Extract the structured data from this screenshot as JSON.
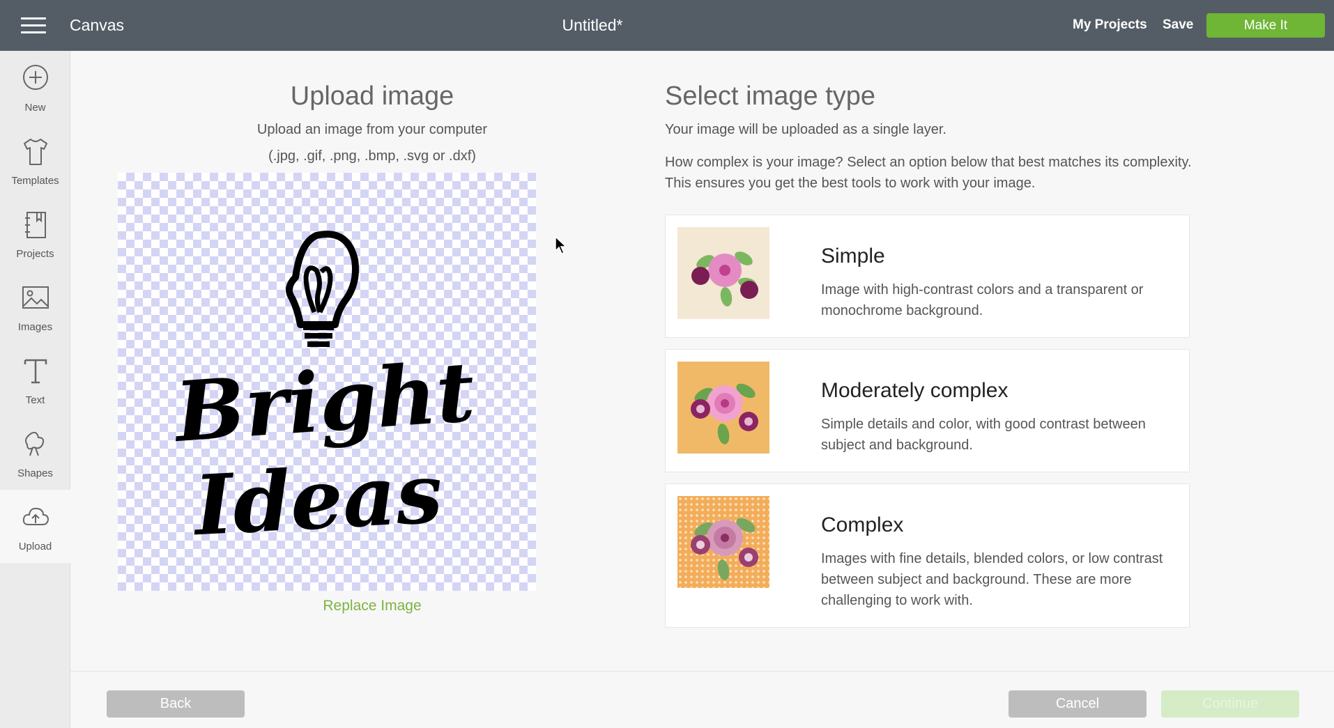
{
  "header": {
    "app_name": "Canvas",
    "doc_title": "Untitled*",
    "my_projects": "My Projects",
    "save": "Save",
    "make_it": "Make It"
  },
  "sidebar": {
    "items": [
      {
        "label": "New",
        "icon": "plus-circle-icon"
      },
      {
        "label": "Templates",
        "icon": "tshirt-icon"
      },
      {
        "label": "Projects",
        "icon": "notebook-icon"
      },
      {
        "label": "Images",
        "icon": "image-icon"
      },
      {
        "label": "Text",
        "icon": "text-t-icon"
      },
      {
        "label": "Shapes",
        "icon": "shapes-icon"
      },
      {
        "label": "Upload",
        "icon": "cloud-upload-icon"
      }
    ],
    "active": "Upload"
  },
  "upload": {
    "title": "Upload image",
    "subtitle": "Upload an image from your computer",
    "extensions": "(.jpg, .gif, .png, .bmp, .svg or .dxf)",
    "preview_text_line1": "Bright",
    "preview_text_line2": "Ideas",
    "replace": "Replace Image"
  },
  "select": {
    "title": "Select image type",
    "subtitle": "Your image will be uploaded as a single layer.",
    "description": "How complex is your image? Select an option below that best matches its complexity. This ensures you get the best tools to work with your image.",
    "types": [
      {
        "name": "Simple",
        "description": "Image with high-contrast colors and a transparent or monochrome background."
      },
      {
        "name": "Moderately complex",
        "description": "Simple details and color, with good contrast between subject and background."
      },
      {
        "name": "Complex",
        "description": "Images with fine details, blended colors, or low contrast between subject and background. These are more challenging to work with."
      }
    ]
  },
  "footer": {
    "back": "Back",
    "cancel": "Cancel",
    "continue": "Continue"
  },
  "colors": {
    "topbar": "#545d66",
    "accent_green": "#6fb536",
    "link_green": "#7cb342",
    "button_gray": "#bdbdbd",
    "continue_disabled": "#d5ecc7"
  }
}
